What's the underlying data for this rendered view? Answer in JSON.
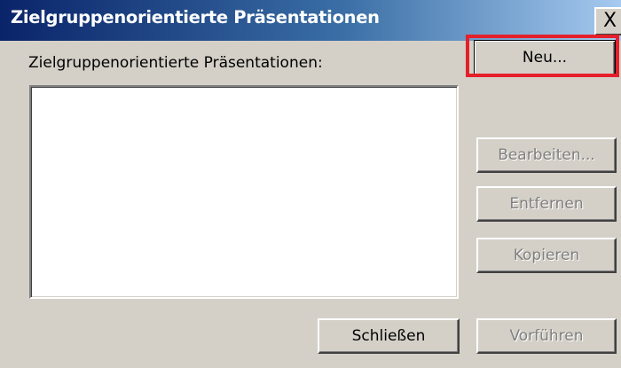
{
  "window": {
    "title": "Zielgruppenorientierte Präsentationen",
    "close_glyph": "X"
  },
  "list": {
    "label": "Zielgruppenorientierte Präsentationen:",
    "items": []
  },
  "buttons": {
    "new": "Neu...",
    "edit": "Bearbeiten...",
    "remove": "Entfernen",
    "copy": "Kopieren",
    "close": "Schließen",
    "show": "Vorführen"
  },
  "colors": {
    "highlight": "#e4202a",
    "titlebar_start": "#0a246a",
    "titlebar_end": "#a6caf0",
    "dialog_bg": "#d4d0c8"
  }
}
